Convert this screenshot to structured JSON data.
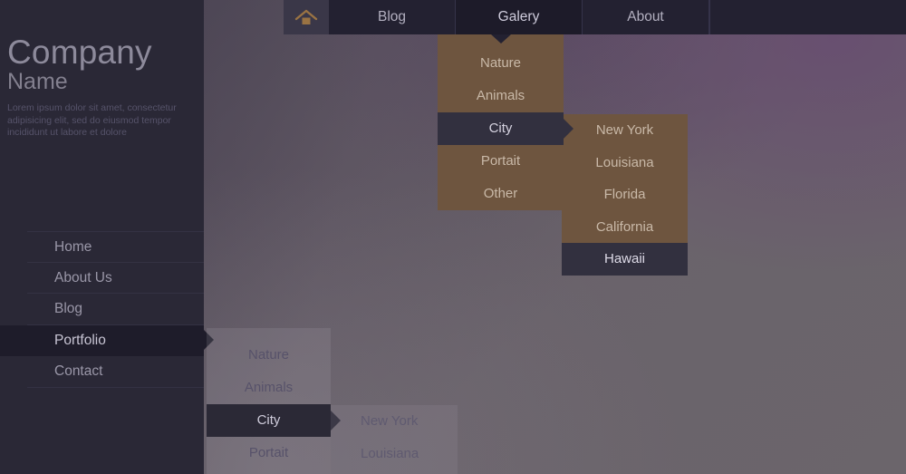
{
  "brand": {
    "title_line1": "Company",
    "title_line2": "Name",
    "description": "Lorem ipsum dolor sit amet, consectetur adipisicing elit, sed do eiusmod tempor incididunt ut labore et dolore"
  },
  "sidebar": {
    "items": [
      {
        "label": "Home",
        "active": false
      },
      {
        "label": "About Us",
        "active": false
      },
      {
        "label": "Blog",
        "active": false
      },
      {
        "label": "Portfolio",
        "active": true
      },
      {
        "label": "Contact",
        "active": false
      }
    ]
  },
  "topnav": {
    "home_icon": "home-icon",
    "items": [
      {
        "label": "Blog",
        "active": false
      },
      {
        "label": "Galery",
        "active": true
      },
      {
        "label": "About",
        "active": false
      }
    ]
  },
  "gallery_menu": {
    "items": [
      {
        "label": "Nature",
        "selected": false
      },
      {
        "label": "Animals",
        "selected": false
      },
      {
        "label": "City",
        "selected": true
      },
      {
        "label": "Portait",
        "selected": false
      },
      {
        "label": "Other",
        "selected": false
      }
    ]
  },
  "gallery_submenu": {
    "items": [
      {
        "label": "New York",
        "selected": false
      },
      {
        "label": "Louisiana",
        "selected": false
      },
      {
        "label": "Florida",
        "selected": false
      },
      {
        "label": "California",
        "selected": false
      },
      {
        "label": "Hawaii",
        "selected": true
      }
    ]
  },
  "portfolio_menu": {
    "items": [
      {
        "label": "Nature",
        "selected": false
      },
      {
        "label": "Animals",
        "selected": false
      },
      {
        "label": "City",
        "selected": true
      },
      {
        "label": "Portait",
        "selected": false
      }
    ]
  },
  "portfolio_submenu": {
    "items": [
      {
        "label": "New York",
        "selected": false
      },
      {
        "label": "Louisiana",
        "selected": false
      }
    ]
  },
  "colors": {
    "sidebar_bg": "#2a2836",
    "topnav_bg": "#232131",
    "dropdown_tan": "#6e553f",
    "selected_dark": "#32303f",
    "accent_icon": "#9a7343"
  }
}
